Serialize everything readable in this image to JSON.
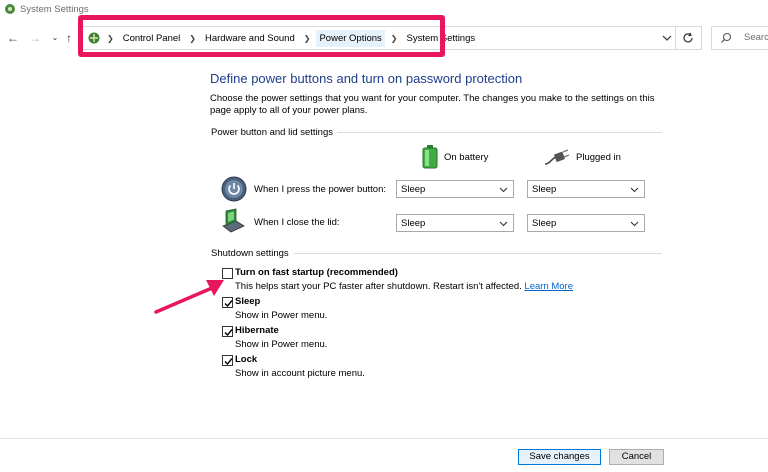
{
  "window": {
    "title": "System Settings"
  },
  "address_bar": {
    "breadcrumbs": [
      "Control Panel",
      "Hardware and Sound",
      "Power Options",
      "System Settings"
    ]
  },
  "search": {
    "placeholder": "Search"
  },
  "page": {
    "heading": "Define power buttons and turn on password protection",
    "description": "Choose the power settings that you want for your computer. The changes you make to the settings on this page apply to all of your power plans."
  },
  "power_section": {
    "title": "Power button and lid settings",
    "col_battery": "On battery",
    "col_plugged": "Plugged in",
    "rows": [
      {
        "label": "When I press the power button:",
        "battery": "Sleep",
        "plugged": "Sleep"
      },
      {
        "label": "When I close the lid:",
        "battery": "Sleep",
        "plugged": "Sleep"
      }
    ]
  },
  "shutdown_section": {
    "title": "Shutdown settings",
    "options": [
      {
        "title": "Turn on fast startup (recommended)",
        "desc": "This helps start your PC faster after shutdown. Restart isn't affected.",
        "link": "Learn More",
        "checked": false
      },
      {
        "title": "Sleep",
        "desc": "Show in Power menu.",
        "checked": true
      },
      {
        "title": "Hibernate",
        "desc": "Show in Power menu.",
        "checked": true
      },
      {
        "title": "Lock",
        "desc": "Show in account picture menu.",
        "checked": true
      }
    ]
  },
  "footer": {
    "save_label": "Save changes",
    "cancel_label": "Cancel"
  },
  "colors": {
    "highlight": "#e8175d",
    "heading": "#1e3e8c",
    "link": "#0066cc",
    "primary_border": "#0078d7"
  }
}
